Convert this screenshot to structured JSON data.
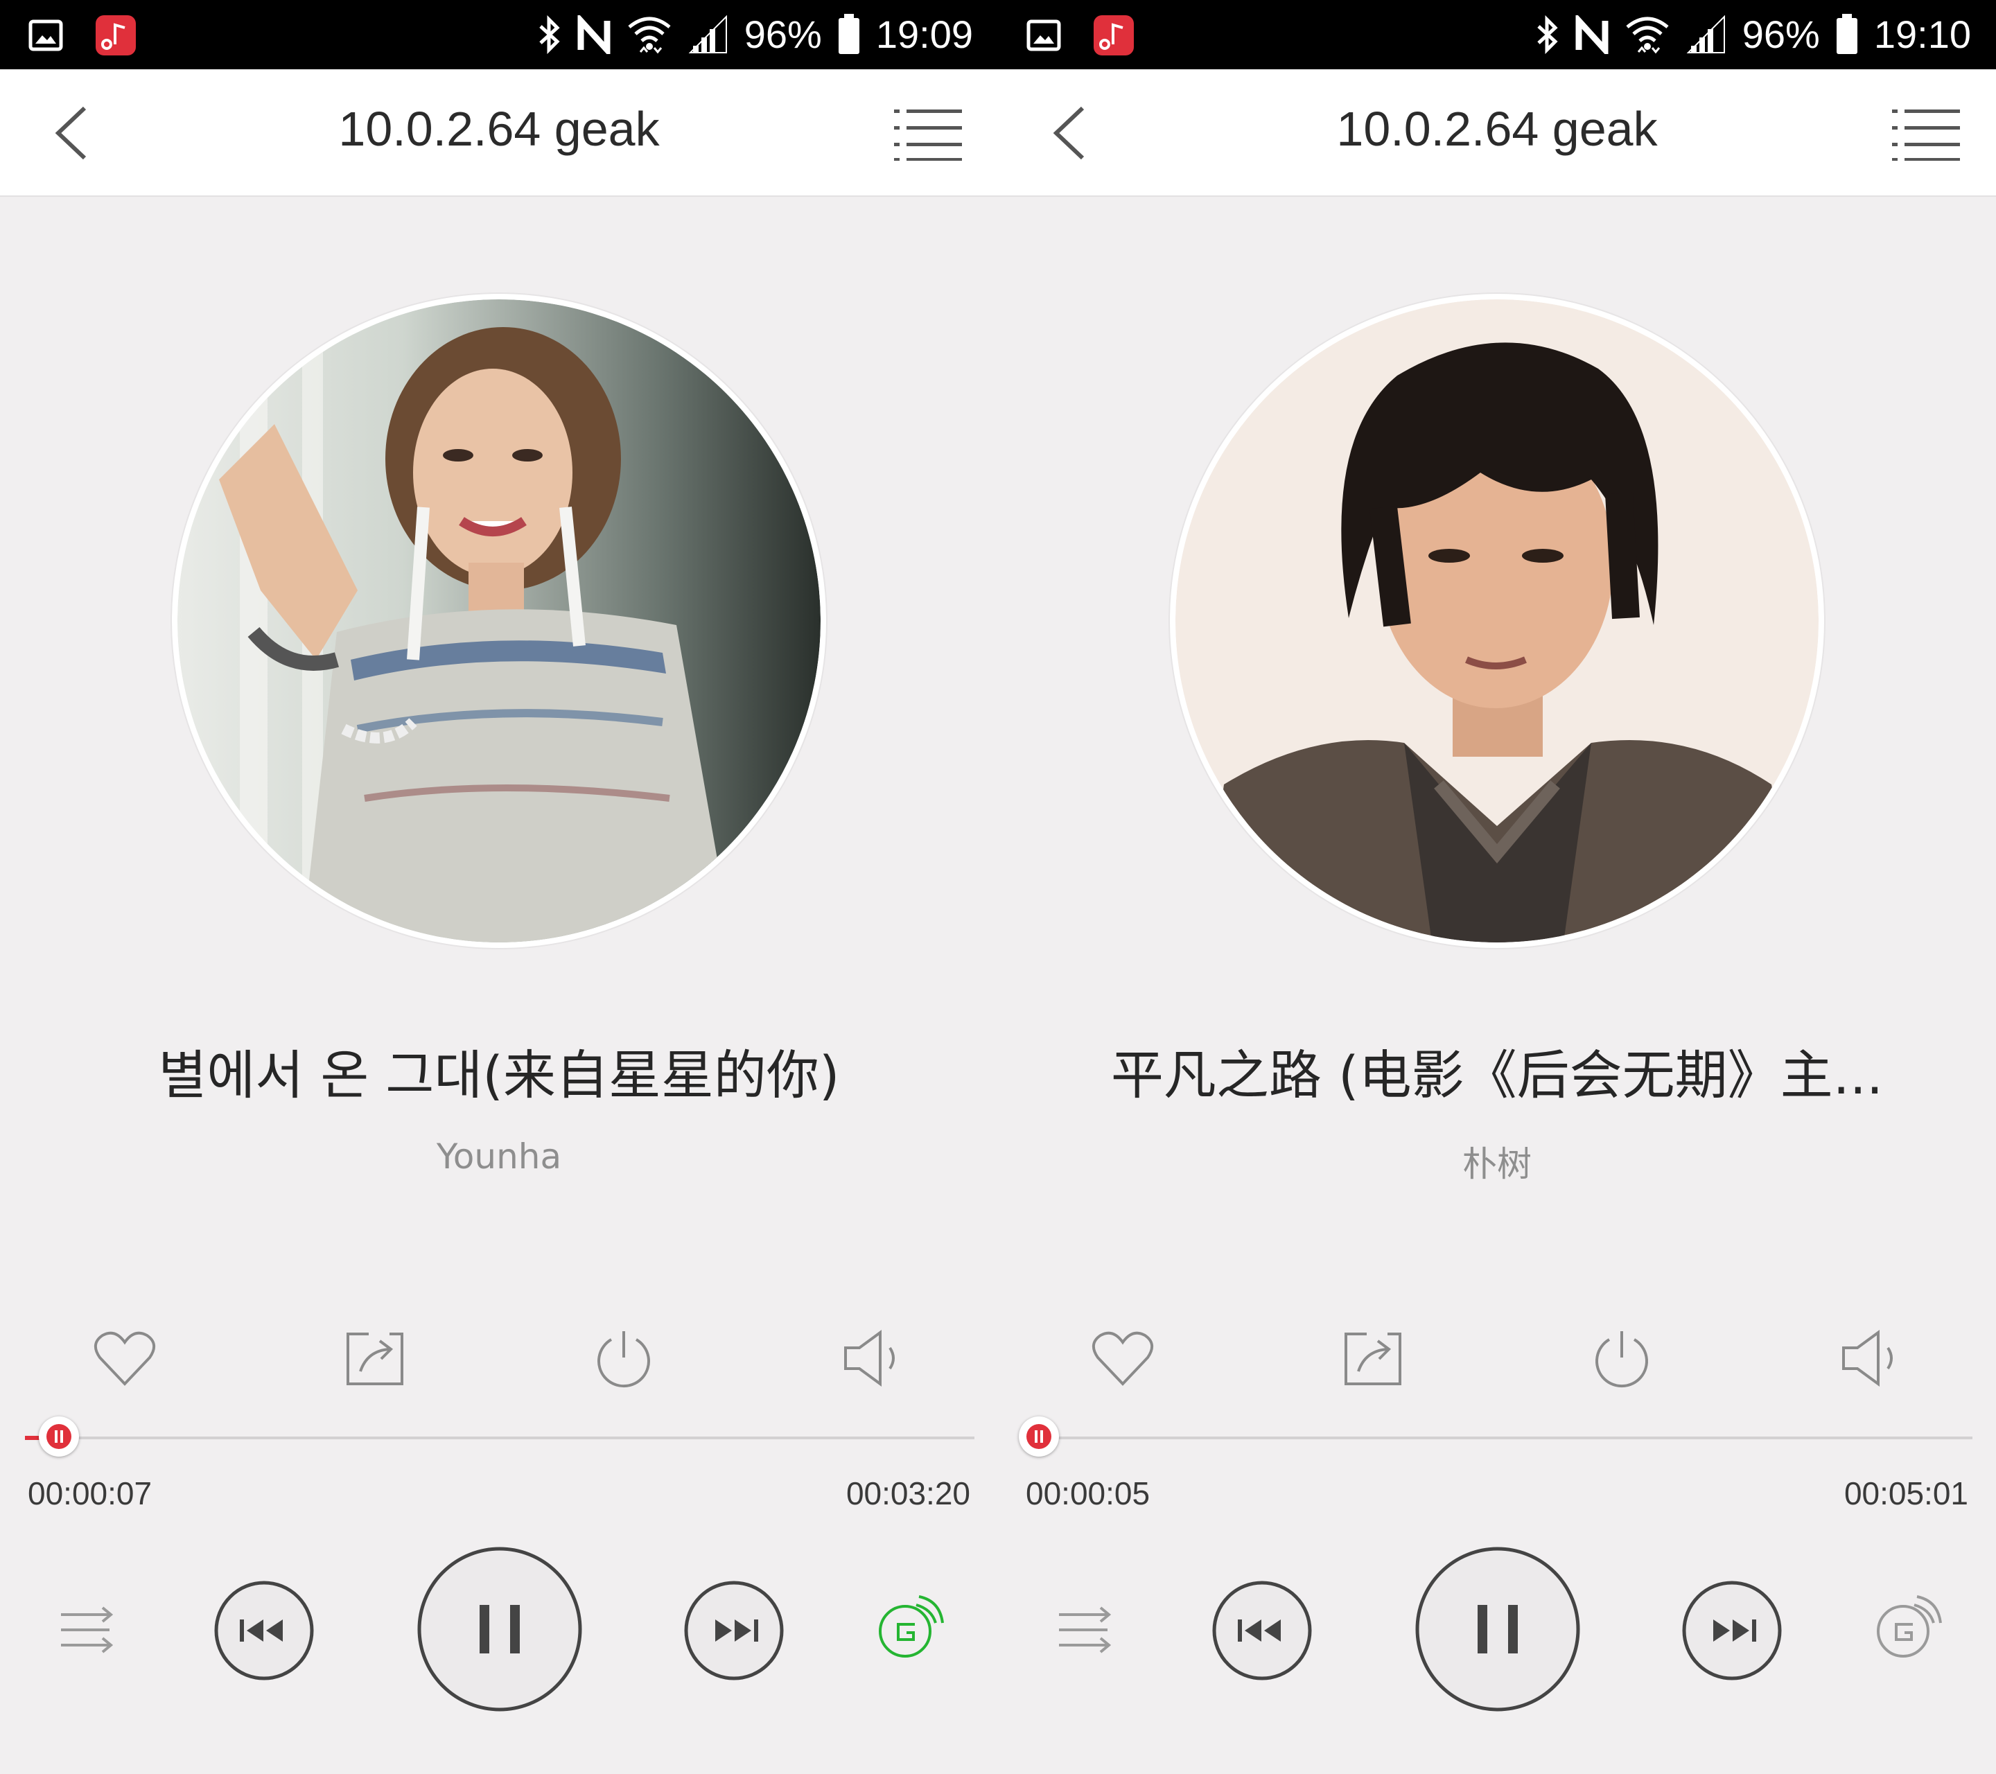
{
  "screens": [
    {
      "status": {
        "battery": "96%",
        "time": "19:09"
      },
      "header": {
        "title": "10.0.2.64 geak"
      },
      "song": {
        "title": "별에서 온 그대(来自星星的你)",
        "artist": "Younha"
      },
      "progress": {
        "current": "00:00:07",
        "total": "00:03:20",
        "fraction": 0.036
      },
      "repeat_mode_active": true,
      "colors": {
        "accent": "#e0303b",
        "repeat_active": "#25b532",
        "icon": "#8a8a8a"
      }
    },
    {
      "status": {
        "battery": "96%",
        "time": "19:10"
      },
      "header": {
        "title": "10.0.2.64 geak"
      },
      "song": {
        "title": "平凡之路 (电影《后会无期》主...",
        "artist": "朴树"
      },
      "progress": {
        "current": "00:00:05",
        "total": "00:05:01",
        "fraction": 0.017
      },
      "repeat_mode_active": false,
      "colors": {
        "accent": "#e0303b",
        "repeat_active": "#9a9a9a",
        "icon": "#8a8a8a"
      }
    }
  ]
}
